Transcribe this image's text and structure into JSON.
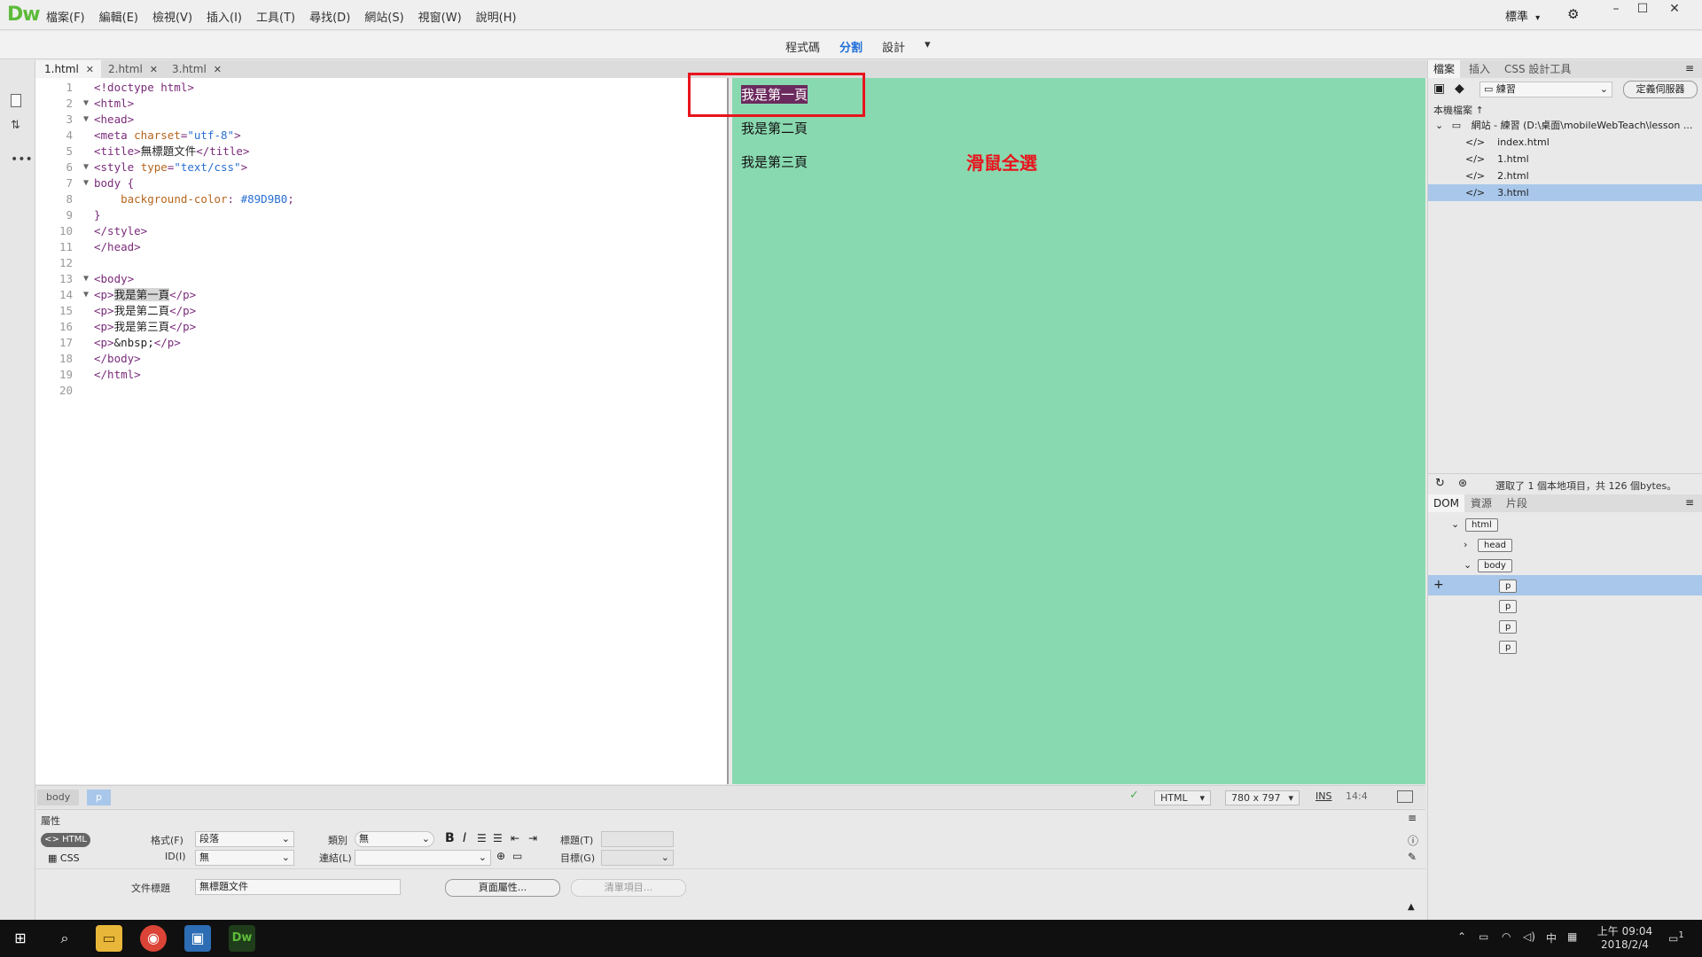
{
  "app": {
    "logo": "Dw",
    "menus": [
      "檔案(F)",
      "編輯(E)",
      "檢視(V)",
      "插入(I)",
      "工具(T)",
      "尋找(D)",
      "網站(S)",
      "視窗(W)",
      "說明(H)"
    ],
    "workspace": "標準",
    "window_buttons": [
      "–",
      "☐",
      "✕"
    ]
  },
  "viewmodes": {
    "code": "程式碼",
    "split": "分割",
    "design": "設計",
    "dropdown": "▾"
  },
  "tabs": [
    {
      "label": "1.html",
      "close": "✕"
    },
    {
      "label": "2.html",
      "close": "✕"
    },
    {
      "label": "3.html",
      "close": "✕"
    }
  ],
  "code": {
    "lines": [
      {
        "n": "1",
        "fold": "",
        "text": "<!doctype html>"
      },
      {
        "n": "2",
        "fold": "▼",
        "text": "<html>"
      },
      {
        "n": "3",
        "fold": "▼",
        "text": "<head>"
      },
      {
        "n": "4",
        "fold": "",
        "pre": "<meta ",
        "attr": "charset",
        "eq": "=",
        "val": "\"utf-8\"",
        "post": ">"
      },
      {
        "n": "5",
        "fold": "",
        "pre": "<title>",
        "txt": "無標題文件",
        "post": "</title>"
      },
      {
        "n": "6",
        "fold": "▼",
        "pre": "<style ",
        "attr": "type",
        "eq": "=",
        "val": "\"text/css\"",
        "post": ">"
      },
      {
        "n": "7",
        "fold": "▼",
        "text": "body {"
      },
      {
        "n": "8",
        "fold": "",
        "pre": "    ",
        "attr": "background-color",
        "eq": ": ",
        "val": "#89D9B0",
        "post": ";"
      },
      {
        "n": "9",
        "fold": "",
        "text": "}"
      },
      {
        "n": "10",
        "fold": "",
        "text": "</style>"
      },
      {
        "n": "11",
        "fold": "",
        "text": "</head>"
      },
      {
        "n": "12",
        "fold": "",
        "text": ""
      },
      {
        "n": "13",
        "fold": "▼",
        "text": "<body>"
      },
      {
        "n": "14",
        "fold": "▼",
        "pre": "<p>",
        "txt": "我是第一頁",
        "post": "</p>",
        "highlight": true
      },
      {
        "n": "15",
        "fold": "",
        "pre": "<p>",
        "txt": "我是第二頁",
        "post": "</p>"
      },
      {
        "n": "16",
        "fold": "",
        "pre": "<p>",
        "txt": "我是第三頁",
        "post": "</p>"
      },
      {
        "n": "17",
        "fold": "",
        "pre": "<p>",
        "txt": "&nbsp;",
        "post": "</p>"
      },
      {
        "n": "18",
        "fold": "",
        "text": "</body>"
      },
      {
        "n": "19",
        "fold": "",
        "text": "</html>"
      },
      {
        "n": "20",
        "fold": "",
        "text": ""
      }
    ]
  },
  "design": {
    "paragraphs": [
      "我是第一頁",
      "我是第二頁",
      "我是第三頁"
    ],
    "annotation": "滑鼠全選",
    "background": "#89D9B0"
  },
  "status": {
    "crumbs": [
      "body",
      "p"
    ],
    "doc_type": "HTML",
    "size": "780 x 797",
    "mode": "INS",
    "position": "14:4"
  },
  "properties": {
    "title": "屬性",
    "html_btn": "HTML",
    "css_btn": "CSS",
    "format_label": "格式(F)",
    "format_value": "段落",
    "id_label": "ID(I)",
    "id_value": "無",
    "class_label": "類別",
    "class_value": "無",
    "link_label": "連結(L)",
    "bold": "B",
    "italic": "I",
    "heading_label": "標題(T)",
    "target_label": "目標(G)",
    "doc_title_label": "文件標題",
    "doc_title_value": "無標題文件",
    "page_props_btn": "頁面屬性...",
    "list_item_btn": "清單項目..."
  },
  "files_panel": {
    "tabs": [
      "檔案",
      "插入",
      "CSS 設計工具"
    ],
    "site_select": "練習",
    "define_server": "定義伺服器",
    "local_files": "本機檔案",
    "site_root": "網站 - 練習 (D:\\桌面\\mobileWebTeach\\lesson ...",
    "files": [
      "index.html",
      "1.html",
      "2.html",
      "3.html"
    ],
    "selected_file": "3.html",
    "status": "選取了 1 個本地項目，共 126 個bytes。"
  },
  "dom_panel": {
    "tabs": [
      "DOM",
      "資源",
      "片段"
    ],
    "nodes": [
      {
        "tag": "html",
        "depth": 0,
        "toggle": "⌄"
      },
      {
        "tag": "head",
        "depth": 1,
        "toggle": "›"
      },
      {
        "tag": "body",
        "depth": 1,
        "toggle": "⌄"
      },
      {
        "tag": "p",
        "depth": 2,
        "toggle": "",
        "selected": true
      },
      {
        "tag": "p",
        "depth": 2,
        "toggle": ""
      },
      {
        "tag": "p",
        "depth": 2,
        "toggle": ""
      },
      {
        "tag": "p",
        "depth": 2,
        "toggle": ""
      }
    ],
    "add": "+"
  },
  "taskbar": {
    "time": "上午 09:04",
    "date": "2018/2/4",
    "ime": "中",
    "notif": "1",
    "dw_label": "Dw"
  },
  "colors": {
    "accent": "#1e6fd9",
    "selection": "#a8c7ea",
    "annotation": "#e8141d",
    "design_bg": "#89D9B0"
  }
}
